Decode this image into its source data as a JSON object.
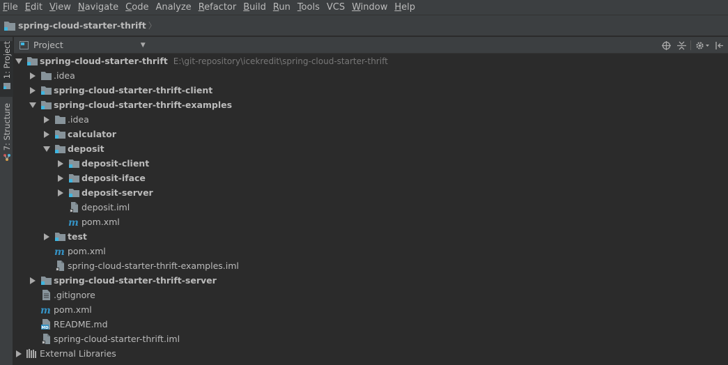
{
  "menubar": {
    "items": [
      {
        "mn": "F",
        "rest": "ile"
      },
      {
        "mn": "E",
        "rest": "dit"
      },
      {
        "mn": "V",
        "rest": "iew"
      },
      {
        "mn": "N",
        "rest": "avigate"
      },
      {
        "mn": "C",
        "rest": "ode"
      },
      {
        "mn": "",
        "rest": "Analyze"
      },
      {
        "mn": "R",
        "rest": "efactor"
      },
      {
        "mn": "B",
        "rest": "uild"
      },
      {
        "mn": "R",
        "rest": "un"
      },
      {
        "mn": "T",
        "rest": "ools"
      },
      {
        "mn": "",
        "rest": "VCS"
      },
      {
        "mn": "W",
        "rest": "indow"
      },
      {
        "mn": "H",
        "rest": "elp"
      }
    ]
  },
  "navbar": {
    "crumb": "spring-cloud-starter-thrift",
    "separator": "〉"
  },
  "toolstrip": {
    "project_tab": "1: Project",
    "structure_tab": "7: Structure"
  },
  "panel": {
    "title": "Project",
    "dropdown_glyph": "▼"
  },
  "tree": {
    "rows": [
      {
        "label": "spring-cloud-starter-thrift",
        "path": "E:\\git-repository\\icekredit\\spring-cloud-starter-thrift",
        "bold": true,
        "depth": 0,
        "arrow": "down",
        "icon": "module-folder-icon"
      },
      {
        "label": ".idea",
        "bold": false,
        "depth": 1,
        "arrow": "right",
        "icon": "folder-icon"
      },
      {
        "label": "spring-cloud-starter-thrift-client",
        "bold": true,
        "depth": 1,
        "arrow": "right",
        "icon": "module-folder-icon"
      },
      {
        "label": "spring-cloud-starter-thrift-examples",
        "bold": true,
        "depth": 1,
        "arrow": "down",
        "icon": "module-folder-icon"
      },
      {
        "label": ".idea",
        "bold": false,
        "depth": 2,
        "arrow": "right",
        "icon": "folder-icon"
      },
      {
        "label": "calculator",
        "bold": true,
        "depth": 2,
        "arrow": "right",
        "icon": "module-folder-icon"
      },
      {
        "label": "deposit",
        "bold": true,
        "depth": 2,
        "arrow": "down",
        "icon": "module-folder-icon"
      },
      {
        "label": "deposit-client",
        "bold": true,
        "depth": 3,
        "arrow": "right",
        "icon": "module-folder-icon"
      },
      {
        "label": "deposit-iface",
        "bold": true,
        "depth": 3,
        "arrow": "right",
        "icon": "module-folder-icon"
      },
      {
        "label": "deposit-server",
        "bold": true,
        "depth": 3,
        "arrow": "right",
        "icon": "module-folder-icon"
      },
      {
        "label": "deposit.iml",
        "bold": false,
        "depth": 3,
        "arrow": "none",
        "icon": "iml-file-icon"
      },
      {
        "label": "pom.xml",
        "bold": false,
        "depth": 3,
        "arrow": "none",
        "icon": "maven-icon"
      },
      {
        "label": "test",
        "bold": true,
        "depth": 2,
        "arrow": "right",
        "icon": "module-folder-icon"
      },
      {
        "label": "pom.xml",
        "bold": false,
        "depth": 2,
        "arrow": "none",
        "icon": "maven-icon"
      },
      {
        "label": "spring-cloud-starter-thrift-examples.iml",
        "bold": false,
        "depth": 2,
        "arrow": "none",
        "icon": "iml-file-icon"
      },
      {
        "label": "spring-cloud-starter-thrift-server",
        "bold": true,
        "depth": 1,
        "arrow": "right",
        "icon": "module-folder-icon"
      },
      {
        "label": ".gitignore",
        "bold": false,
        "depth": 1,
        "arrow": "none",
        "icon": "text-file-icon"
      },
      {
        "label": "pom.xml",
        "bold": false,
        "depth": 1,
        "arrow": "none",
        "icon": "maven-icon"
      },
      {
        "label": "README.md",
        "bold": false,
        "depth": 1,
        "arrow": "none",
        "icon": "markdown-file-icon"
      },
      {
        "label": "spring-cloud-starter-thrift.iml",
        "bold": false,
        "depth": 1,
        "arrow": "none",
        "icon": "iml-file-icon"
      },
      {
        "label": "External Libraries",
        "bold": false,
        "depth": 0,
        "arrow": "right",
        "icon": "libraries-icon"
      }
    ]
  },
  "colors": {
    "background": "#2b2b2b",
    "chrome": "#3c3f41",
    "text": "#bbbbbb",
    "path_text": "#787878",
    "folder": "#87939a",
    "module_blue": "#40b6e0"
  }
}
